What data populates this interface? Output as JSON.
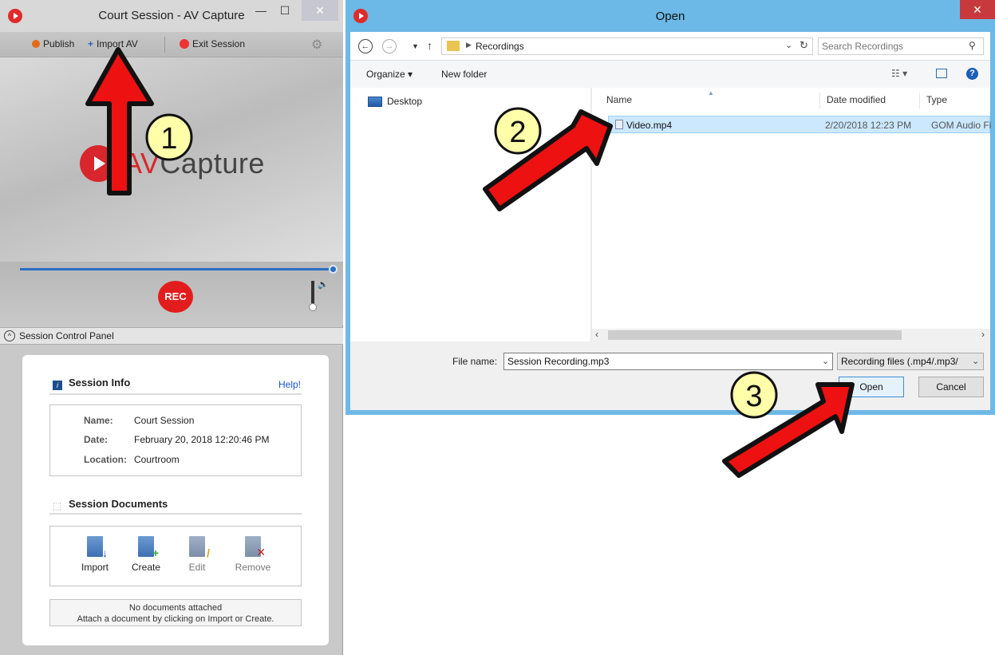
{
  "av_window": {
    "title": "Court Session - AV Capture",
    "toolbar": {
      "publish_label": "Publish",
      "import_label": "Import AV",
      "exit_label": "Exit Session"
    },
    "logo": {
      "text_prefix": "AV",
      "text_suffix": "Capture",
      "brand_color": "#d8262c"
    },
    "rec_label": "REC",
    "panel_header": "Session Control Panel",
    "session_info": {
      "title": "Session Info",
      "help_link": "Help!",
      "name_label": "Name:",
      "name_value": "Court Session",
      "date_label": "Date:",
      "date_value": "February 20, 2018 12:20:46 PM",
      "location_label": "Location:",
      "location_value": "Courtroom"
    },
    "session_documents": {
      "title": "Session Documents",
      "actions": [
        "Import",
        "Create",
        "Edit",
        "Remove"
      ],
      "empty_line1": "No documents attached",
      "empty_line2": "Attach a document by clicking on Import or Create."
    }
  },
  "open_dialog": {
    "title": "Open",
    "breadcrumb": "Recordings",
    "search_placeholder": "Search Recordings",
    "organize_label": "Organize ▾",
    "new_folder_label": "New folder",
    "nav_items": [
      "Desktop"
    ],
    "columns": {
      "name": "Name",
      "date": "Date modified",
      "type": "Type"
    },
    "files": [
      {
        "name": "Video.mp4",
        "date": "2/20/2018 12:23 PM",
        "type": "GOM Audio Fi"
      }
    ],
    "file_name_label": "File name:",
    "file_name_value": "Session Recording.mp3",
    "file_type_value": "Recording files (.mp4/.mp3/",
    "open_label": "Open",
    "cancel_label": "Cancel",
    "accent_color": "#6cb8e6"
  },
  "annotations": {
    "step1": "1",
    "step2": "2",
    "step3": "3",
    "arrow_color": "#ee1111",
    "badge_color": "#ffffaa"
  }
}
